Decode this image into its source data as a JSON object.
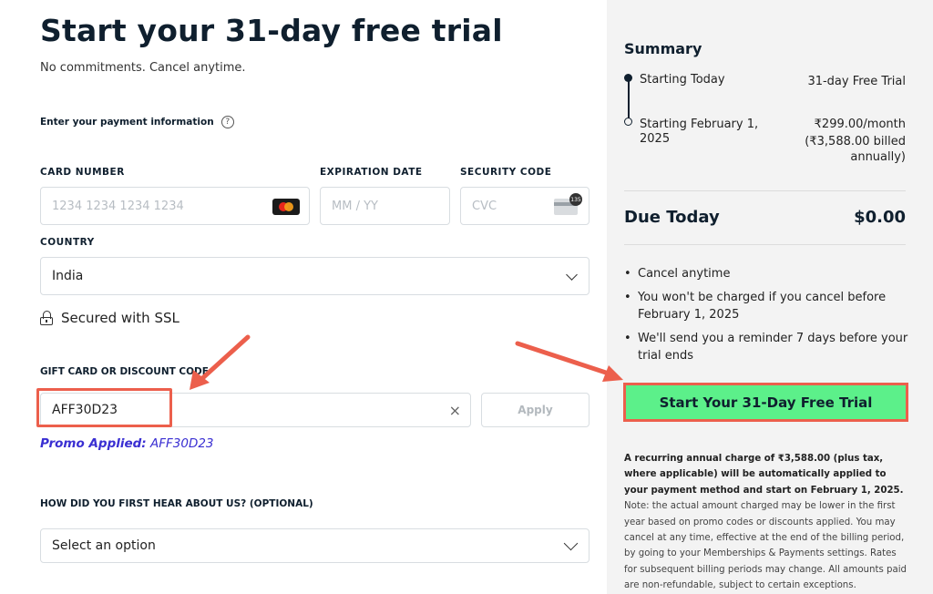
{
  "header": {
    "title": "Start your 31-day free trial",
    "subtitle": "No commitments. Cancel anytime."
  },
  "payment": {
    "section_label": "Enter your payment information",
    "help_icon": "question-circle-icon",
    "card_number": {
      "label": "CARD NUMBER",
      "placeholder": "1234 1234 1234 1234",
      "icon": "mastercard-icon"
    },
    "expiration": {
      "label": "EXPIRATION DATE",
      "placeholder": "MM / YY"
    },
    "security": {
      "label": "SECURITY CODE",
      "placeholder": "CVC",
      "icon": "cvc-card-icon",
      "icon_badge": "135"
    },
    "country": {
      "label": "COUNTRY",
      "value": "India"
    },
    "ssl_text": "Secured with SSL"
  },
  "discount": {
    "label": "GIFT CARD OR DISCOUNT CODE",
    "value": "AFF30D23",
    "clear_glyph": "×",
    "apply_label": "Apply",
    "promo_prefix": "Promo Applied:",
    "promo_code": "AFF30D23"
  },
  "referral": {
    "label": "HOW DID YOU FIRST HEAR ABOUT US? (OPTIONAL)",
    "value": "Select an option"
  },
  "summary": {
    "title": "Summary",
    "rows": [
      {
        "label": "Starting Today",
        "value": "31-day Free Trial"
      },
      {
        "label_line1": "Starting February 1,",
        "label_line2": "2025",
        "value": "₹299.00/month",
        "value_line2": "(₹3,588.00 billed",
        "value_line3": "annually)"
      }
    ],
    "due_label": "Due Today",
    "due_value": "$0.00",
    "bullets": [
      "Cancel anytime",
      "You won't be charged if you cancel before February 1, 2025",
      "We'll send you a reminder 7 days before your trial ends"
    ],
    "cta_label": "Start Your 31-Day Free Trial",
    "legal_bold": "A recurring annual charge of ₹3,588.00 (plus tax, where applicable) will be automatically applied to your payment method and start on February 1, 2025.",
    "legal_rest": " Note: the actual amount charged may be lower in the first year based on promo codes or discounts applied. You may cancel at any time, effective at the end of the billing period, by going to your Memberships & Payments settings. Rates for subsequent billing periods may change. All amounts paid are non-refundable, subject to certain exceptions."
  },
  "colors": {
    "accent_green": "#5cf08a",
    "annotation_red": "#ec5f4c",
    "promo_blue": "#3a2fd2",
    "panel_gray": "#f3f3f3"
  }
}
